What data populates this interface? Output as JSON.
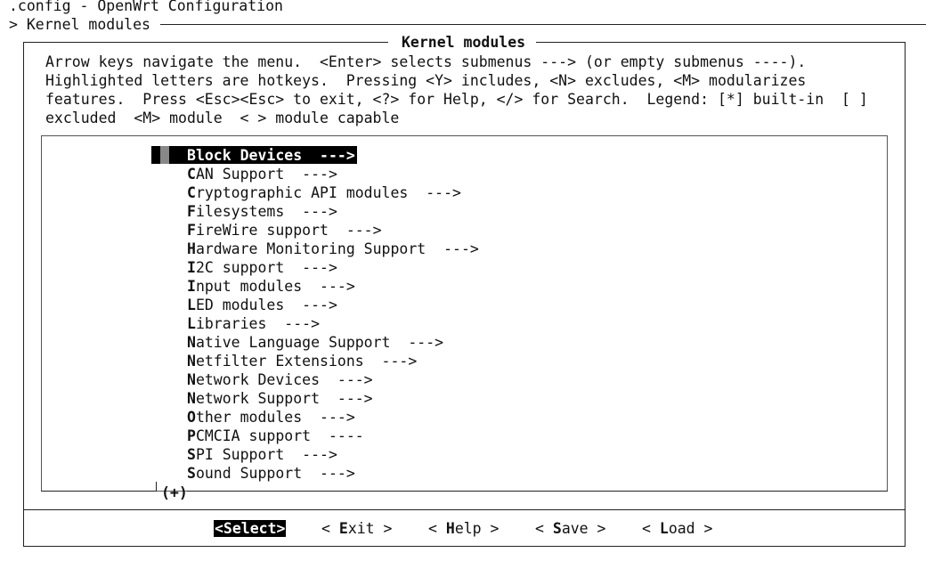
{
  "app": {
    "title": ".config - OpenWrt Configuration",
    "breadcrumb": "> Kernel modules"
  },
  "dialog": {
    "title": "Kernel modules",
    "help_lines": [
      "Arrow keys navigate the menu.  <Enter> selects submenus ---> (or empty submenus ----).",
      "Highlighted letters are hotkeys.  Pressing <Y> includes, <N> excludes, <M> modularizes",
      "features.  Press <Esc><Esc> to exit, <?> for Help, </> for Search.  Legend: [*] built-in  [ ]",
      "excluded  <M> module  < > module capable"
    ],
    "menu_items": [
      {
        "hot": "B",
        "rest": "lock Devices  --->",
        "selected": true
      },
      {
        "hot": "C",
        "rest": "AN Support  --->"
      },
      {
        "hot": "C",
        "rest": "ryptographic API modules  --->"
      },
      {
        "hot": "F",
        "rest": "ilesystems  --->"
      },
      {
        "hot": "F",
        "rest": "ireWire support  --->"
      },
      {
        "hot": "H",
        "rest": "ardware Monitoring Support  --->"
      },
      {
        "hot": "I",
        "rest": "2C support  --->"
      },
      {
        "hot": "I",
        "rest": "nput modules  --->"
      },
      {
        "hot": "L",
        "rest": "ED modules  --->"
      },
      {
        "hot": "L",
        "rest": "ibraries  --->"
      },
      {
        "hot": "N",
        "rest": "ative Language Support  --->"
      },
      {
        "hot": "N",
        "rest": "etfilter Extensions  --->"
      },
      {
        "hot": "N",
        "rest": "etwork Devices  --->"
      },
      {
        "hot": "N",
        "rest": "etwork Support  --->"
      },
      {
        "hot": "O",
        "rest": "ther modules  --->"
      },
      {
        "hot": "P",
        "rest": "CMCIA support  ----"
      },
      {
        "hot": "S",
        "rest": "PI Support  --->"
      },
      {
        "hot": "S",
        "rest": "ound Support  --->"
      }
    ],
    "more_indicator": "(+)",
    "buttons": {
      "select": "<Select>",
      "exit_pre": "< ",
      "exit_hot": "E",
      "exit_rest": "xit >",
      "help_pre": "< ",
      "help_hot": "H",
      "help_rest": "elp >",
      "save_pre": "< ",
      "save_hot": "S",
      "save_rest": "ave >",
      "load_pre": "< ",
      "load_hot": "L",
      "load_rest": "oad >"
    }
  }
}
